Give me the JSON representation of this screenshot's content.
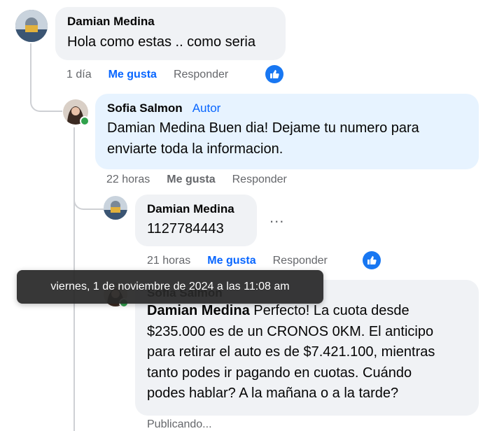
{
  "comments": [
    {
      "author": "Damian Medina",
      "text": "Hola como estas .. como seria",
      "time": "1 día",
      "like_label": "Me gusta",
      "reply_label": "Responder",
      "reaction": "like-icon"
    },
    {
      "author": "Sofia Salmon",
      "badge": "Autor",
      "text_line1": "Damian Medina Buen dia! Dejame tu numero para",
      "text_line2": "enviarte toda la informacion.",
      "time": "22 horas",
      "like_label": "Me gusta",
      "reply_label": "Responder"
    },
    {
      "author": "Damian Medina",
      "text": "1127784443",
      "time": "21 horas",
      "like_label": "Me gusta",
      "reply_label": "Responder",
      "more": "...",
      "reaction": "like-icon"
    },
    {
      "author": "Sofia Salmon",
      "mention": "Damian Medina",
      "text_line1": " Perfecto! La cuota desde",
      "text_line2": "$235.000 es de un CRONOS 0KM. El anticipo",
      "text_line3": "para retirar el auto es de $7.421.100, mientras",
      "text_line4": "tanto podes ir pagando en cuotas. Cuándo",
      "text_line5": "podes hablar? A la mañana o a la tarde?",
      "status": "Publicando..."
    }
  ],
  "tooltip": "viernes, 1 de noviembre de 2024 a las 11:08 am",
  "colors": {
    "accent": "#0866ff",
    "bubble_gray": "#f0f2f5",
    "bubble_blue": "#e7f3ff",
    "online": "#31a24c"
  }
}
